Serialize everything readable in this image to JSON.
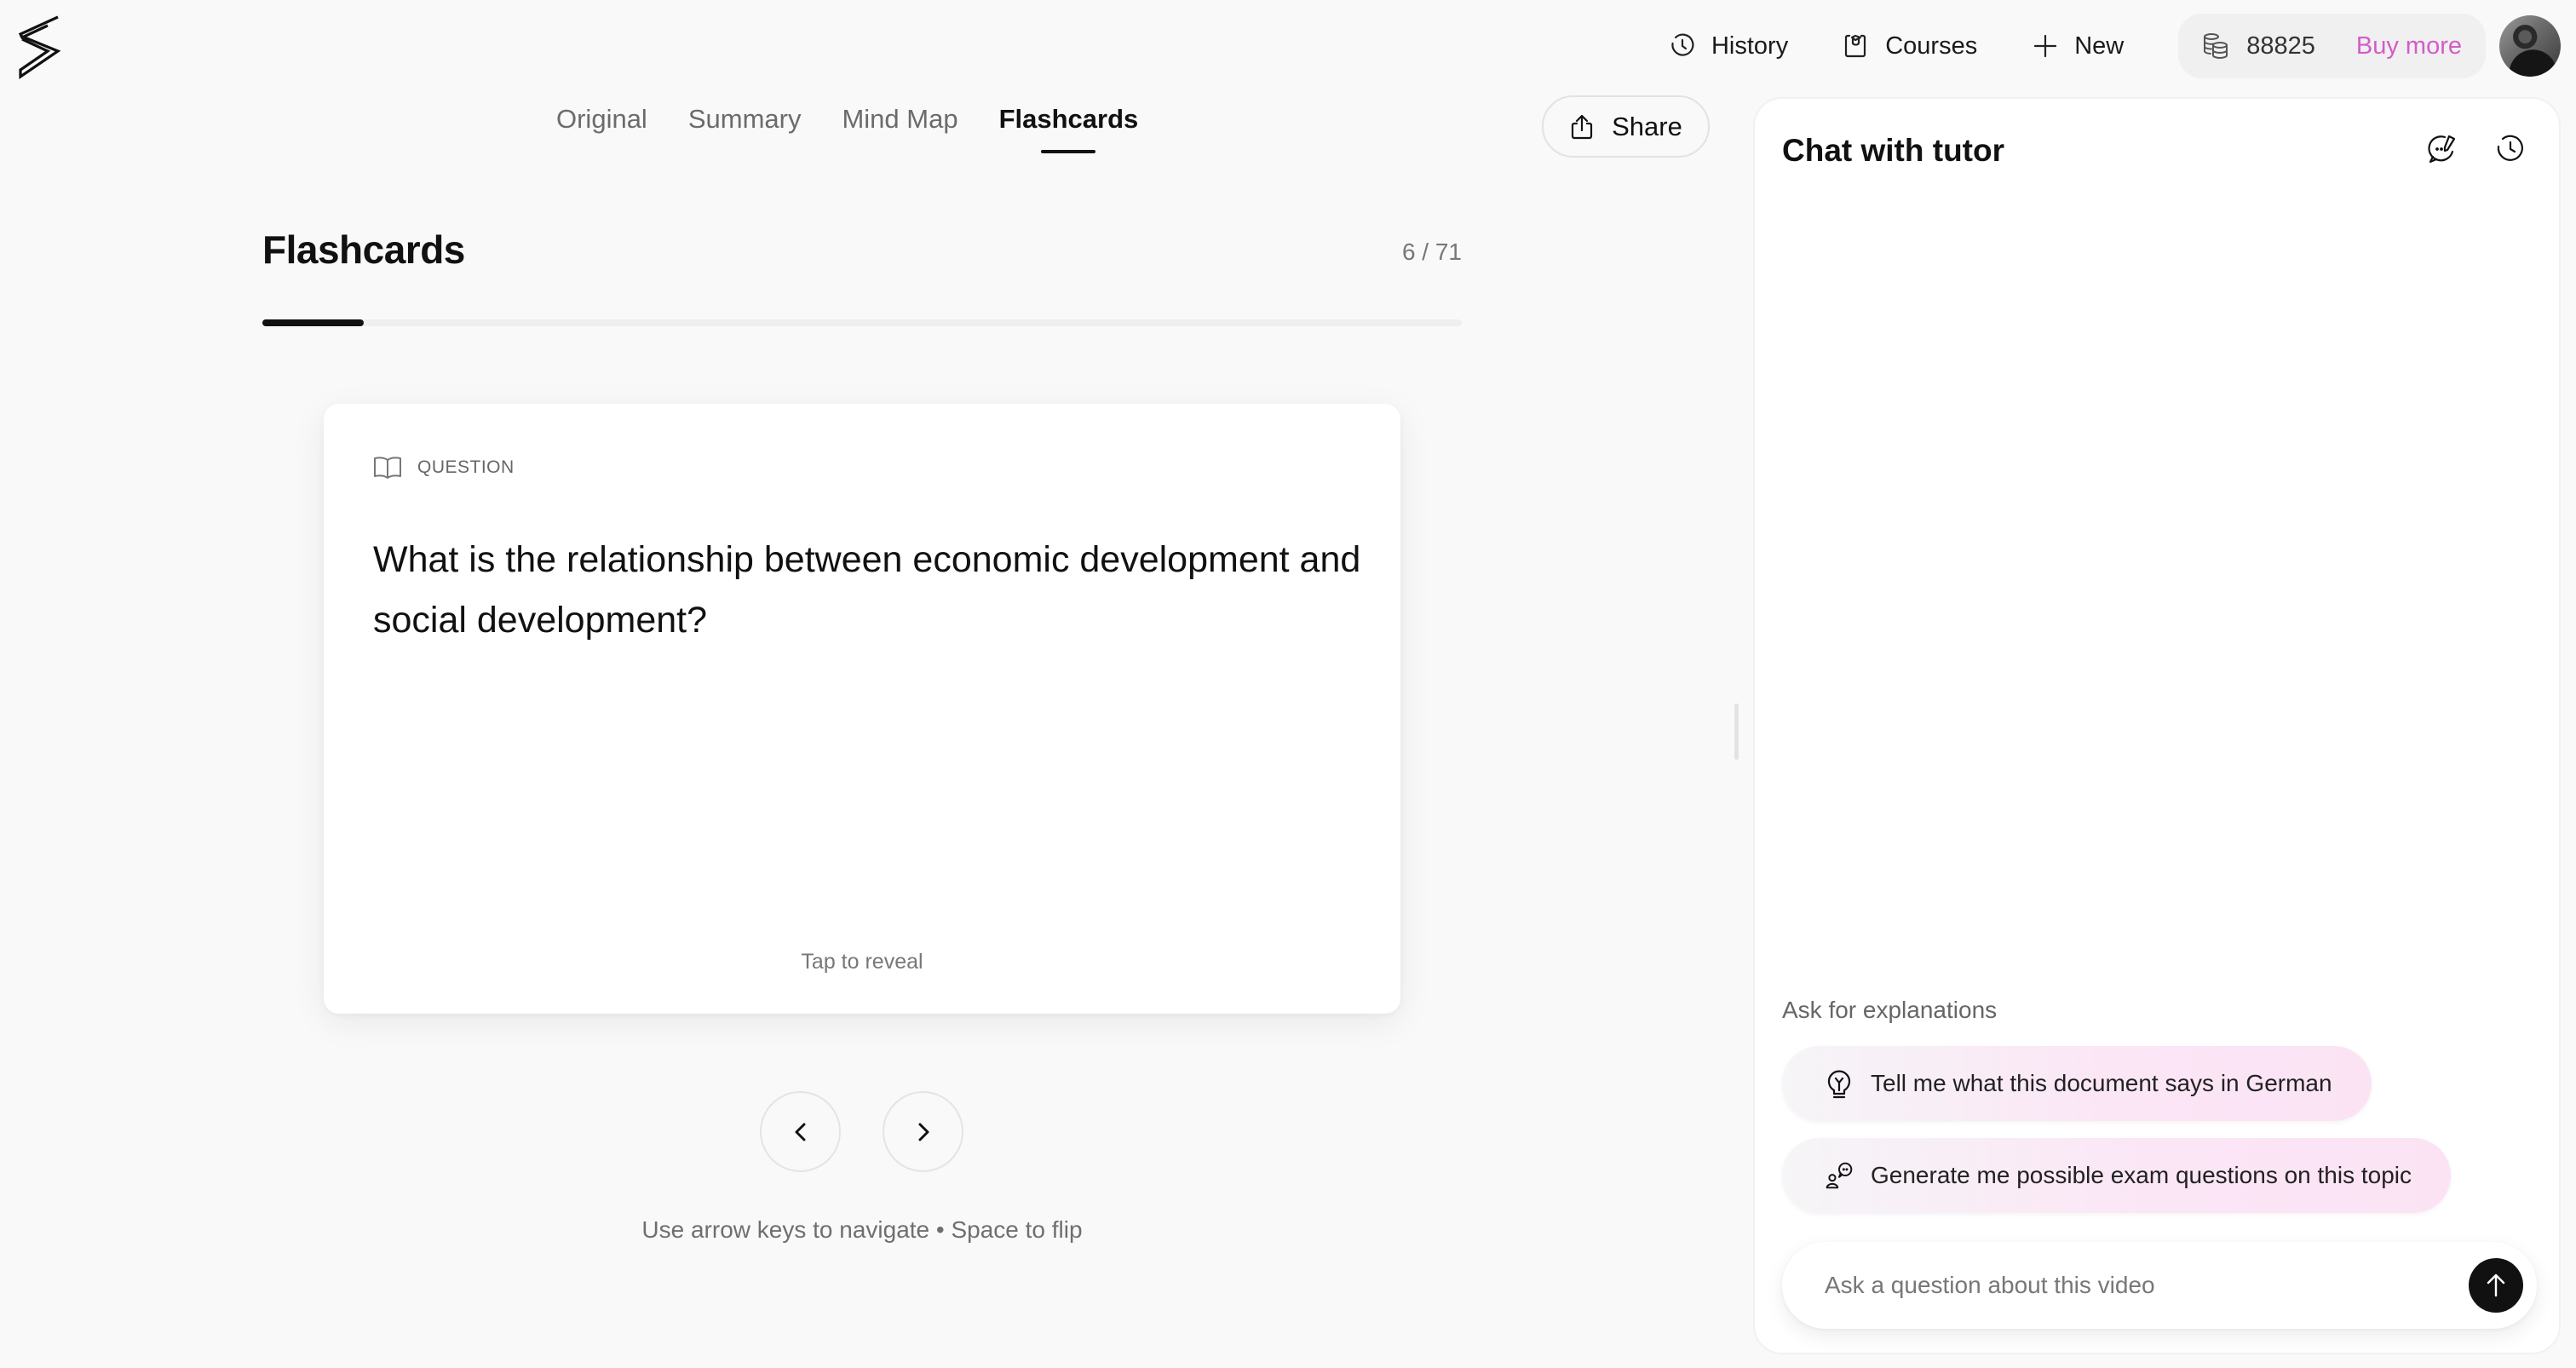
{
  "app": {
    "logo_icon": "lightning-s-logo-icon"
  },
  "topnav": {
    "items": [
      {
        "label": "History",
        "icon": "history-clock-icon"
      },
      {
        "label": "Courses",
        "icon": "courses-icon"
      },
      {
        "label": "New",
        "icon": "plus-icon"
      }
    ],
    "credits": {
      "icon": "coins-stack-icon",
      "value": "88825",
      "buy_label": "Buy more"
    },
    "avatar": "user-avatar",
    "accent_color": "#d35cc8"
  },
  "tabs": [
    {
      "label": "Original",
      "active": false
    },
    {
      "label": "Summary",
      "active": false
    },
    {
      "label": "Mind Map",
      "active": false
    },
    {
      "label": "Flashcards",
      "active": true
    }
  ],
  "share": {
    "label": "Share",
    "icon": "share-upload-icon"
  },
  "flashcards": {
    "title": "Flashcards",
    "current": 6,
    "total": 71,
    "counter_text": "6 / 71",
    "progress_fraction": 0.0845,
    "card": {
      "label_icon": "open-book-icon",
      "label": "QUESTION",
      "question": "What is the relationship between economic development and social development?",
      "hint": "Tap to reveal"
    },
    "prev_icon": "chevron-left-icon",
    "next_icon": "chevron-right-icon",
    "keyboard_hint": "Use arrow keys to navigate • Space to flip"
  },
  "chat": {
    "title": "Chat with tutor",
    "header_icons": [
      "new-chat-icon",
      "chat-history-icon"
    ],
    "suggestions_label": "Ask for explanations",
    "suggestions": [
      {
        "label": "Tell me what this document says in German",
        "icon": "lightbulb-icon"
      },
      {
        "label": "Generate me possible exam questions on this topic",
        "icon": "person-speech-icon"
      }
    ],
    "input_placeholder": "Ask a question about this video",
    "input_value": "",
    "send_icon": "arrow-up-icon"
  }
}
